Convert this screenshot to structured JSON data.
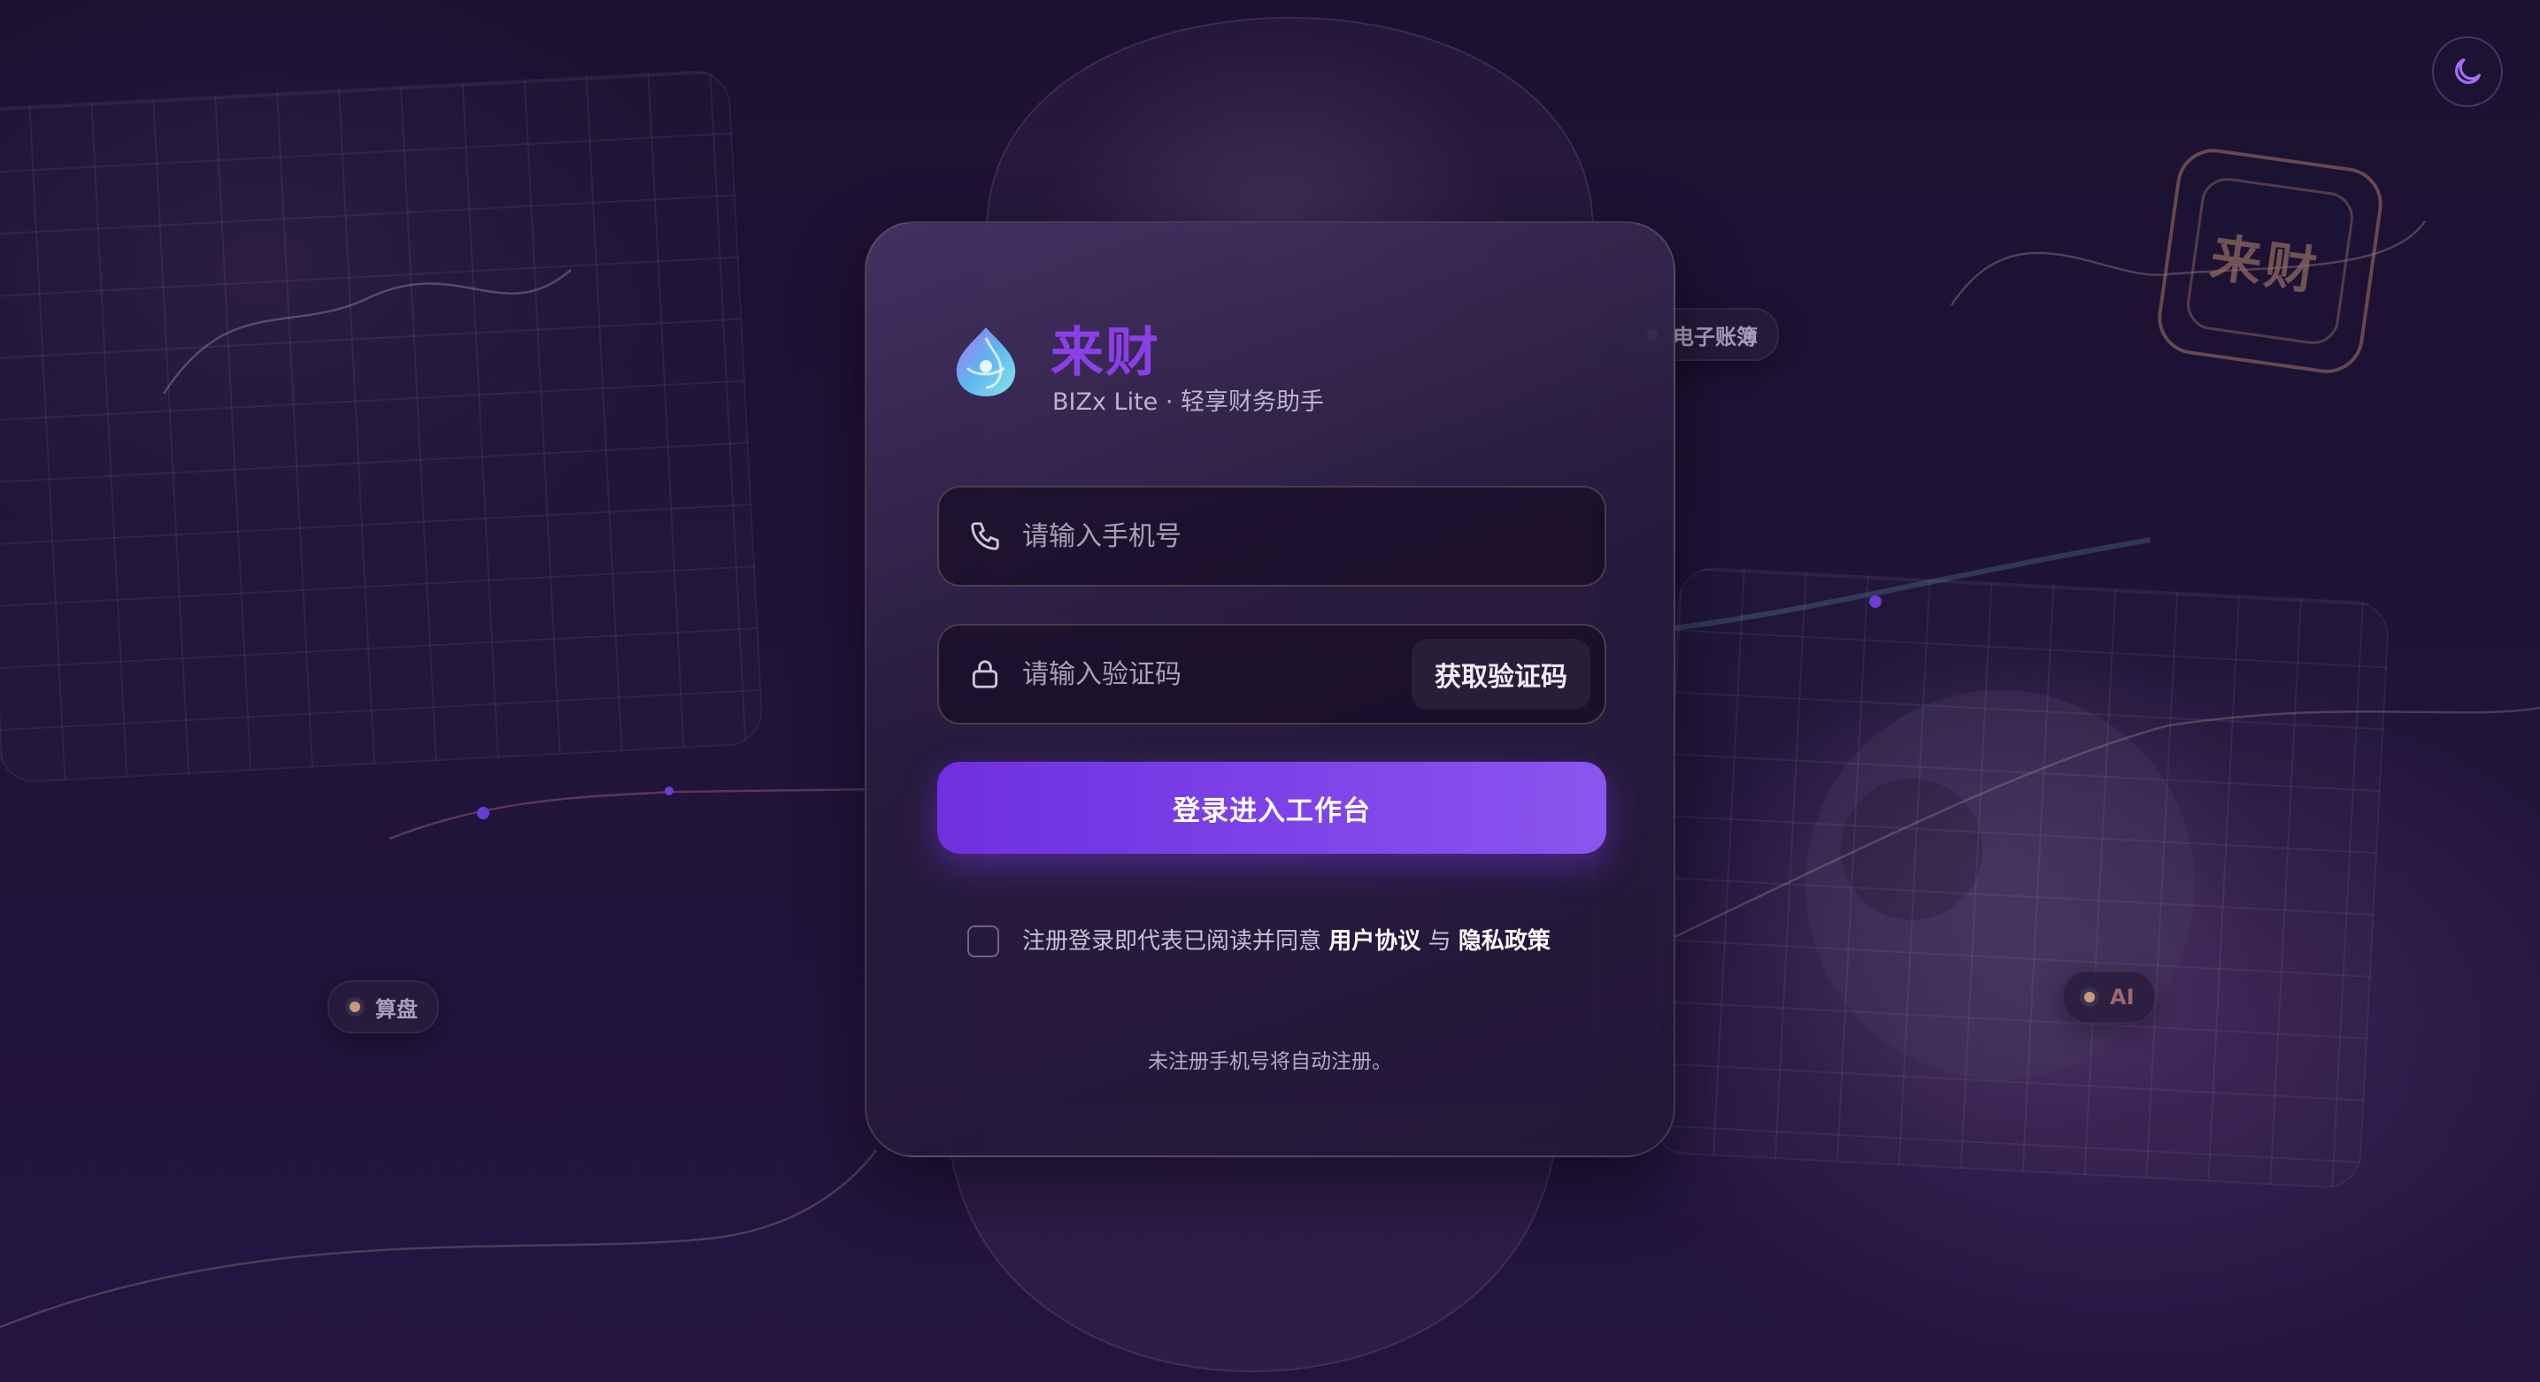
{
  "brand": {
    "name": "来财",
    "subtitle": "BIZx Lite · 轻享财务助手"
  },
  "background_tags": {
    "ledger": "电子账簿",
    "abacus": "算盘",
    "ai": "AI",
    "stamp_text": "来财"
  },
  "form": {
    "phone_placeholder": "请输入手机号",
    "code_placeholder": "请输入验证码",
    "get_code_label": "获取验证码",
    "login_label": "登录进入工作台"
  },
  "agreement": {
    "prefix": "注册登录即代表已阅读并同意",
    "user_agreement": "用户协议",
    "and": "与",
    "privacy_policy": "隐私政策",
    "checked": false
  },
  "note": "未注册手机号将自动注册。",
  "colors": {
    "accent": "#8b3fe6",
    "button_start": "#6f2fe0",
    "button_end": "#8a55f0",
    "background": "#1b1130"
  },
  "icons": {
    "theme_toggle": "moon-icon",
    "phone_field": "phone-icon",
    "code_field": "lock-icon",
    "logo": "shell-logo-icon"
  }
}
